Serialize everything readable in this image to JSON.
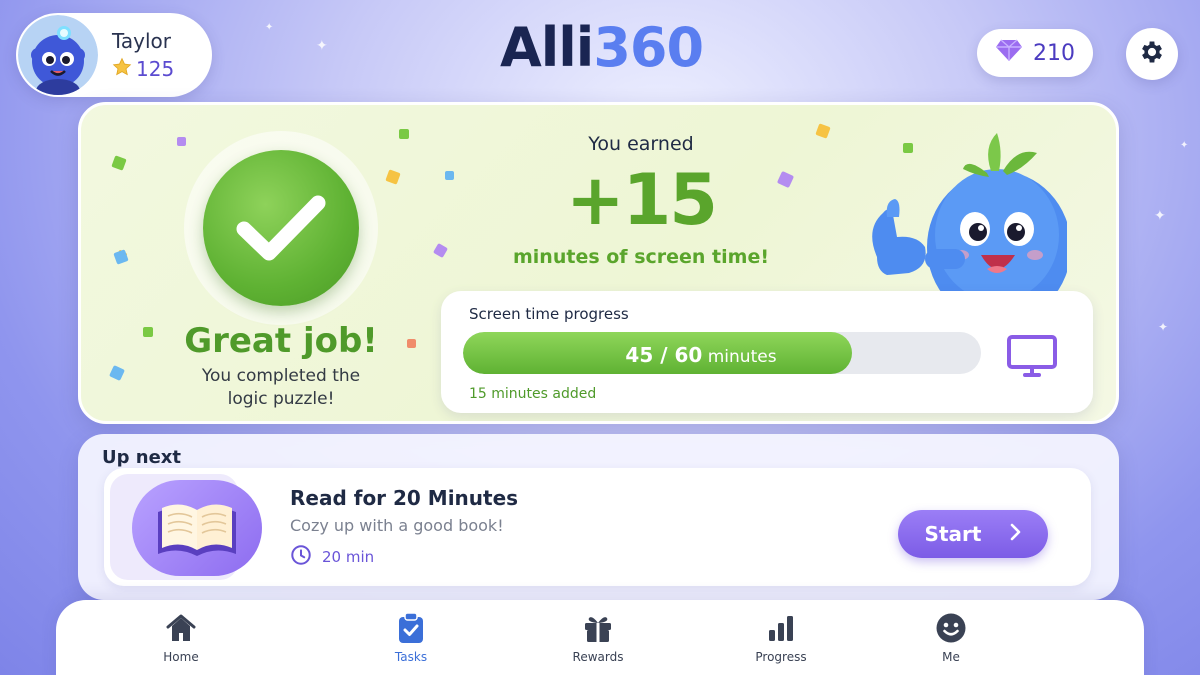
{
  "app": {
    "logo_part1": "Alli",
    "logo_part2": "360"
  },
  "profile": {
    "name": "Taylor",
    "stars": "125"
  },
  "gems": {
    "count": "210"
  },
  "reward": {
    "headline": "Great job!",
    "subtext": "You completed the logic puzzle!",
    "earned_label": "You earned",
    "earned_amount": "+15",
    "earned_unit": "minutes of screen time!"
  },
  "screen_time": {
    "title": "Screen time progress",
    "current": 45,
    "goal": 60,
    "value_text": "45 / 60",
    "unit": "minutes",
    "added_text": "15 minutes added"
  },
  "up_next": {
    "section_title": "Up next",
    "task_title": "Read for 20 Minutes",
    "task_subtitle": "Cozy up with a good book!",
    "duration": "20 min",
    "start_label": "Start"
  },
  "nav": {
    "items": [
      {
        "label": "Home",
        "icon": "home-icon"
      },
      {
        "label": "Tasks",
        "icon": "clipboard-check-icon",
        "active": true
      },
      {
        "label": "Rewards",
        "icon": "gift-icon"
      },
      {
        "label": "Progress",
        "icon": "bar-chart-icon"
      },
      {
        "label": "Me",
        "icon": "smiley-icon"
      }
    ]
  },
  "colors": {
    "brand_dark": "#1a2552",
    "brand_blue": "#5a7ef0",
    "success_green": "#5aa52c",
    "accent_purple": "#7c5ce6",
    "active_nav": "#3b6fd8"
  }
}
